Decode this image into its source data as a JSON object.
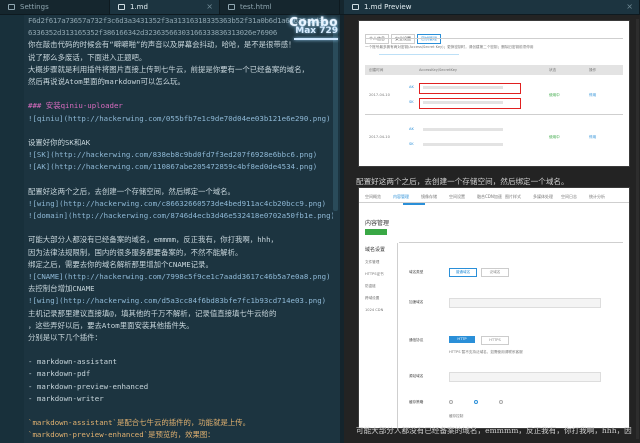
{
  "tabs": [
    {
      "label": "Settings",
      "icon": "settings-icon"
    },
    {
      "label": "1.md",
      "icon": "file-icon"
    },
    {
      "label": "test.html",
      "icon": "file-icon"
    },
    {
      "label": "1.md Preview",
      "icon": "preview-icon"
    }
  ],
  "combo": {
    "label": "Combo",
    "count": "Max 729"
  },
  "editor": {
    "lines": [
      {
        "text": "F6d2f617a73657a732f3c6d3a3431352f3a31316318335363b52f31a0b6d1a6a636a1d3a",
        "kind": "hex"
      },
      {
        "text": "6336352d313165352f386166342d32363566303166333836313026e76906",
        "kind": "hex"
      },
      {
        "text": "你在敲击代码的时候会有“噼噼啪”的声音以及屏幕会抖动，哈哈，是不是很带感！",
        "kind": "text"
      },
      {
        "text": "说了那么多废话，下面进入正题吧。",
        "kind": "text"
      },
      {
        "text": "大概步骤就是利用插件将图片直接上传到七牛云，前提是你要有一个已经备案的域名，",
        "kind": "text"
      },
      {
        "text": "然后再说说Atom里面的markdown可以怎么玩。",
        "kind": "text"
      },
      {
        "text": "",
        "kind": "text"
      },
      {
        "text": "### 安装qiniu-uploader",
        "kind": "heading"
      },
      {
        "text": "![qiniu](http://hackerwing.com/055bfb7e1c9de70d04ee03b121e6e290.png)",
        "kind": "link"
      },
      {
        "text": "",
        "kind": "text"
      },
      {
        "text": "设置好你的SK和AK",
        "kind": "text"
      },
      {
        "text": "![SK](http://hackerwing.com/838eb8c9bd0fd7f3ed207f6928e6bbc6.png)",
        "kind": "link"
      },
      {
        "text": "![AK](http://hackerwing.com/110867abe205472859c4bf8ed0de4534.png)",
        "kind": "link"
      },
      {
        "text": "",
        "kind": "text"
      },
      {
        "text": "配置好这两个之后，去创建一个存储空间，然后绑定一个域名。",
        "kind": "text"
      },
      {
        "text": "![wing](http://hackerwing.com/c86632660573de4bed911ac4cb20bcc9.png)",
        "kind": "link"
      },
      {
        "text": "![domain](http://hackerwing.com/8746d4ecb3d46e532418e0702a50fb1e.png)",
        "kind": "link"
      },
      {
        "text": "",
        "kind": "text"
      },
      {
        "text": "可能大部分人都没有已经备案的域名，emmmm，反正我有，你打我啊，hhh，",
        "kind": "text"
      },
      {
        "text": "因为法律法规限制，国内的很多服务都要备案的，不然不能解析。",
        "kind": "text"
      },
      {
        "text": "绑定之后，需要去你的域名解析那里增加个CNAME记录。",
        "kind": "text"
      },
      {
        "text": "![CNAME](http://hackerwing.com/7998c5f9ce1c7aadd3617c46b5a7e0a8.png)",
        "kind": "link"
      },
      {
        "text": "去控制台增加CNAME",
        "kind": "text"
      },
      {
        "text": "![wing](http://hackerwing.com/d5a3cc84f6bd83bfe7fc1b93cd714e03.png)",
        "kind": "link"
      },
      {
        "text": "主机记录那里建议直接填@，填其他的千万不解析，记录值直接填七牛云给的",
        "kind": "text"
      },
      {
        "text": "，这些弄好以后，要去Atom里面安装其他插件失。",
        "kind": "text"
      },
      {
        "text": "分别是以下几个插件：",
        "kind": "text"
      },
      {
        "text": "",
        "kind": "text"
      },
      {
        "text": "- markdown-assistant",
        "kind": "listi"
      },
      {
        "text": "- markdown-pdf",
        "kind": "listi"
      },
      {
        "text": "- markdown-preview-enhanced",
        "kind": "listi"
      },
      {
        "text": "- markdown-writer",
        "kind": "listi"
      },
      {
        "text": "",
        "kind": "text"
      },
      {
        "text": "`markdown-assistant`是配合七牛云的插件的，功能就是上传。",
        "kind": "code"
      },
      {
        "text": "`markdown-preview-enhanced`是预览的，效果图：",
        "kind": "code"
      }
    ]
  },
  "preview": {
    "caption1": "配置好这两个之后，去创建一个存储空间，然后绑定一个域名。",
    "caption2": "可能大部分人都没有已经备案的域名，emmmm，反正我有，你打我啊，hhh，因",
    "shot1": {
      "tabs": [
        "个人信息",
        "安全设置",
        "密钥管理"
      ],
      "intro": "一个账号最多拥有两对密钥(Access/Secret Key)；更换密钥时，请创建第二个密钥；删除旧密钥前须停用",
      "col_key": "AccessKey/SecretKey",
      "col_time": "创建时间",
      "col_status": "状态",
      "col_action": "操作",
      "row1_time": "2017-04-10",
      "row2_time": "2017-04-10",
      "ak": "AK",
      "sk": "SK",
      "status": "使用中",
      "action": "停用"
    },
    "shot2": {
      "nav": [
        "空间概览",
        "内容管理",
        "镜像存储",
        "空间设置",
        "融合CDN加速",
        "图片样式",
        "多媒体处理",
        "空间日志",
        "统计分析"
      ],
      "title": "内容管理",
      "side": [
        "域名设置",
        "文件管理",
        "HTTPS证书",
        "防盗链",
        "跨域设置",
        "1024 CDN"
      ],
      "labels": [
        "域名类型",
        "加速域名",
        "通信协议",
        "源站域名",
        "缓存策略"
      ],
      "btn1": "普通域名",
      "btn2": "泛域名",
      "btn3": "HTTP",
      "btn4": "HTTPS",
      "proto_note": "HTTPS 暂不支持泛域名，如需使用请联系客服",
      "cache": "缓存控制"
    }
  }
}
